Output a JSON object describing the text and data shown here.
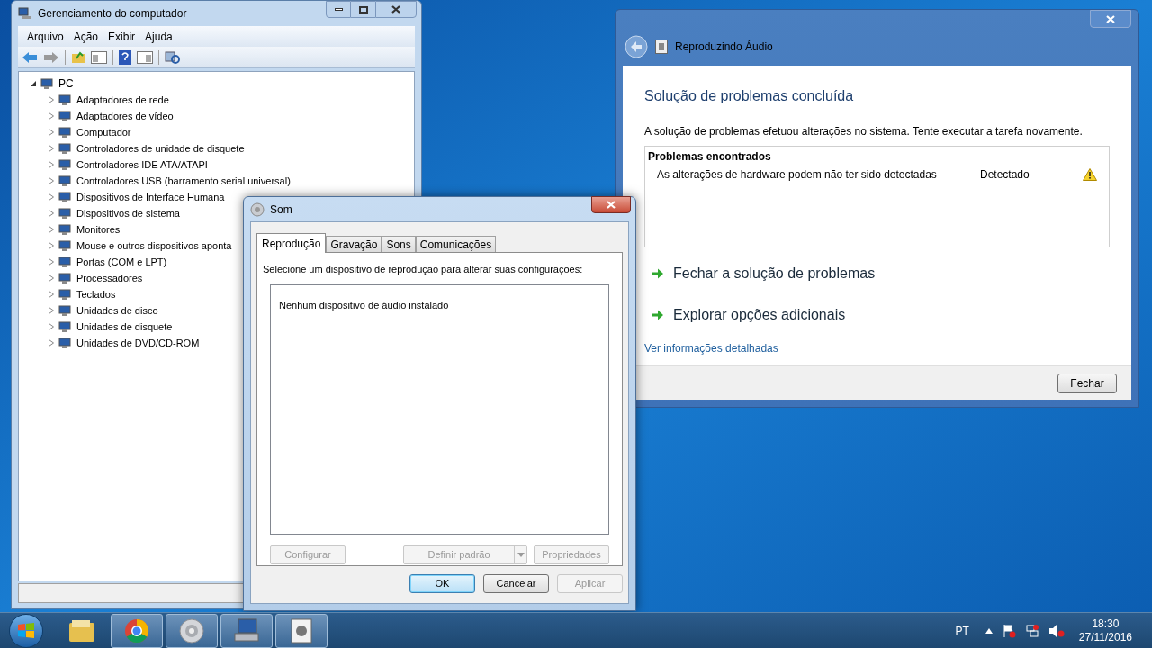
{
  "computer_management": {
    "title": "Gerenciamento do computador",
    "menu": [
      "Arquivo",
      "Ação",
      "Exibir",
      "Ajuda"
    ],
    "tree": [
      {
        "label": "PC",
        "expanded": true,
        "children": [
          {
            "label": "Adaptadores de rede",
            "expanded": false
          },
          {
            "label": "Adaptadores de vídeo",
            "expanded": false
          },
          {
            "label": "Computador",
            "expanded": false
          },
          {
            "label": "Controladores de unidade de disquete",
            "expanded": false
          },
          {
            "label": "Controladores IDE ATA/ATAPI",
            "expanded": false
          },
          {
            "label": "Controladores USB (barramento serial universal)",
            "expanded": false
          },
          {
            "label": "Dispositivos de Interface Humana",
            "expanded": false
          },
          {
            "label": "Dispositivos de sistema",
            "expanded": false
          },
          {
            "label": "Monitores",
            "expanded": false
          },
          {
            "label": "Mouse e outros dispositivos aponta",
            "expanded": false
          },
          {
            "label": "Portas (COM e LPT)",
            "expanded": false
          },
          {
            "label": "Processadores",
            "expanded": false
          },
          {
            "label": "Teclados",
            "expanded": false
          },
          {
            "label": "Unidades de disco",
            "expanded": false
          },
          {
            "label": "Unidades de disquete",
            "expanded": false
          },
          {
            "label": "Unidades de DVD/CD-ROM",
            "expanded": false
          }
        ]
      }
    ]
  },
  "troubleshooter": {
    "title": "Reproduzindo Áudio",
    "heading": "Solução de problemas concluída",
    "message": "A solução de problemas efetuou alterações no sistema. Tente executar a tarefa novamente.",
    "problems_header": "Problemas encontrados",
    "problems": [
      {
        "description": "As alterações de hardware podem não ter sido detectadas",
        "status": "Detectado"
      }
    ],
    "actions": [
      "Fechar a solução de problemas",
      "Explorar opções adicionais"
    ],
    "details_link": "Ver informações detalhadas",
    "close_button": "Fechar"
  },
  "sound_dialog": {
    "title": "Som",
    "tabs": [
      {
        "label": "Reprodução",
        "selected": true
      },
      {
        "label": "Gravação",
        "selected": false
      },
      {
        "label": "Sons",
        "selected": false
      },
      {
        "label": "Comunicações",
        "selected": false
      }
    ],
    "instruction": "Selecione um dispositivo de reprodução para alterar suas configurações:",
    "empty_message": "Nenhum dispositivo de áudio instalado",
    "device_buttons": [
      {
        "label": "Configurar",
        "disabled": true,
        "kind": "plain"
      },
      {
        "label": "Definir padrão",
        "disabled": true,
        "kind": "split"
      },
      {
        "label": "Propriedades",
        "disabled": true,
        "kind": "plain"
      }
    ],
    "footer_buttons": [
      {
        "label": "OK",
        "disabled": false,
        "default": true
      },
      {
        "label": "Cancelar",
        "disabled": false,
        "default": false
      },
      {
        "label": "Aplicar",
        "disabled": true,
        "default": false
      }
    ]
  },
  "taskbar": {
    "items": [
      {
        "kind": "folder",
        "running": false
      },
      {
        "kind": "browser",
        "running": true
      },
      {
        "kind": "speaker",
        "running": true
      },
      {
        "kind": "computer",
        "running": true
      },
      {
        "kind": "troubleshooter",
        "running": true
      }
    ],
    "language": "PT",
    "time": "18:30",
    "date": "27/11/2016"
  }
}
